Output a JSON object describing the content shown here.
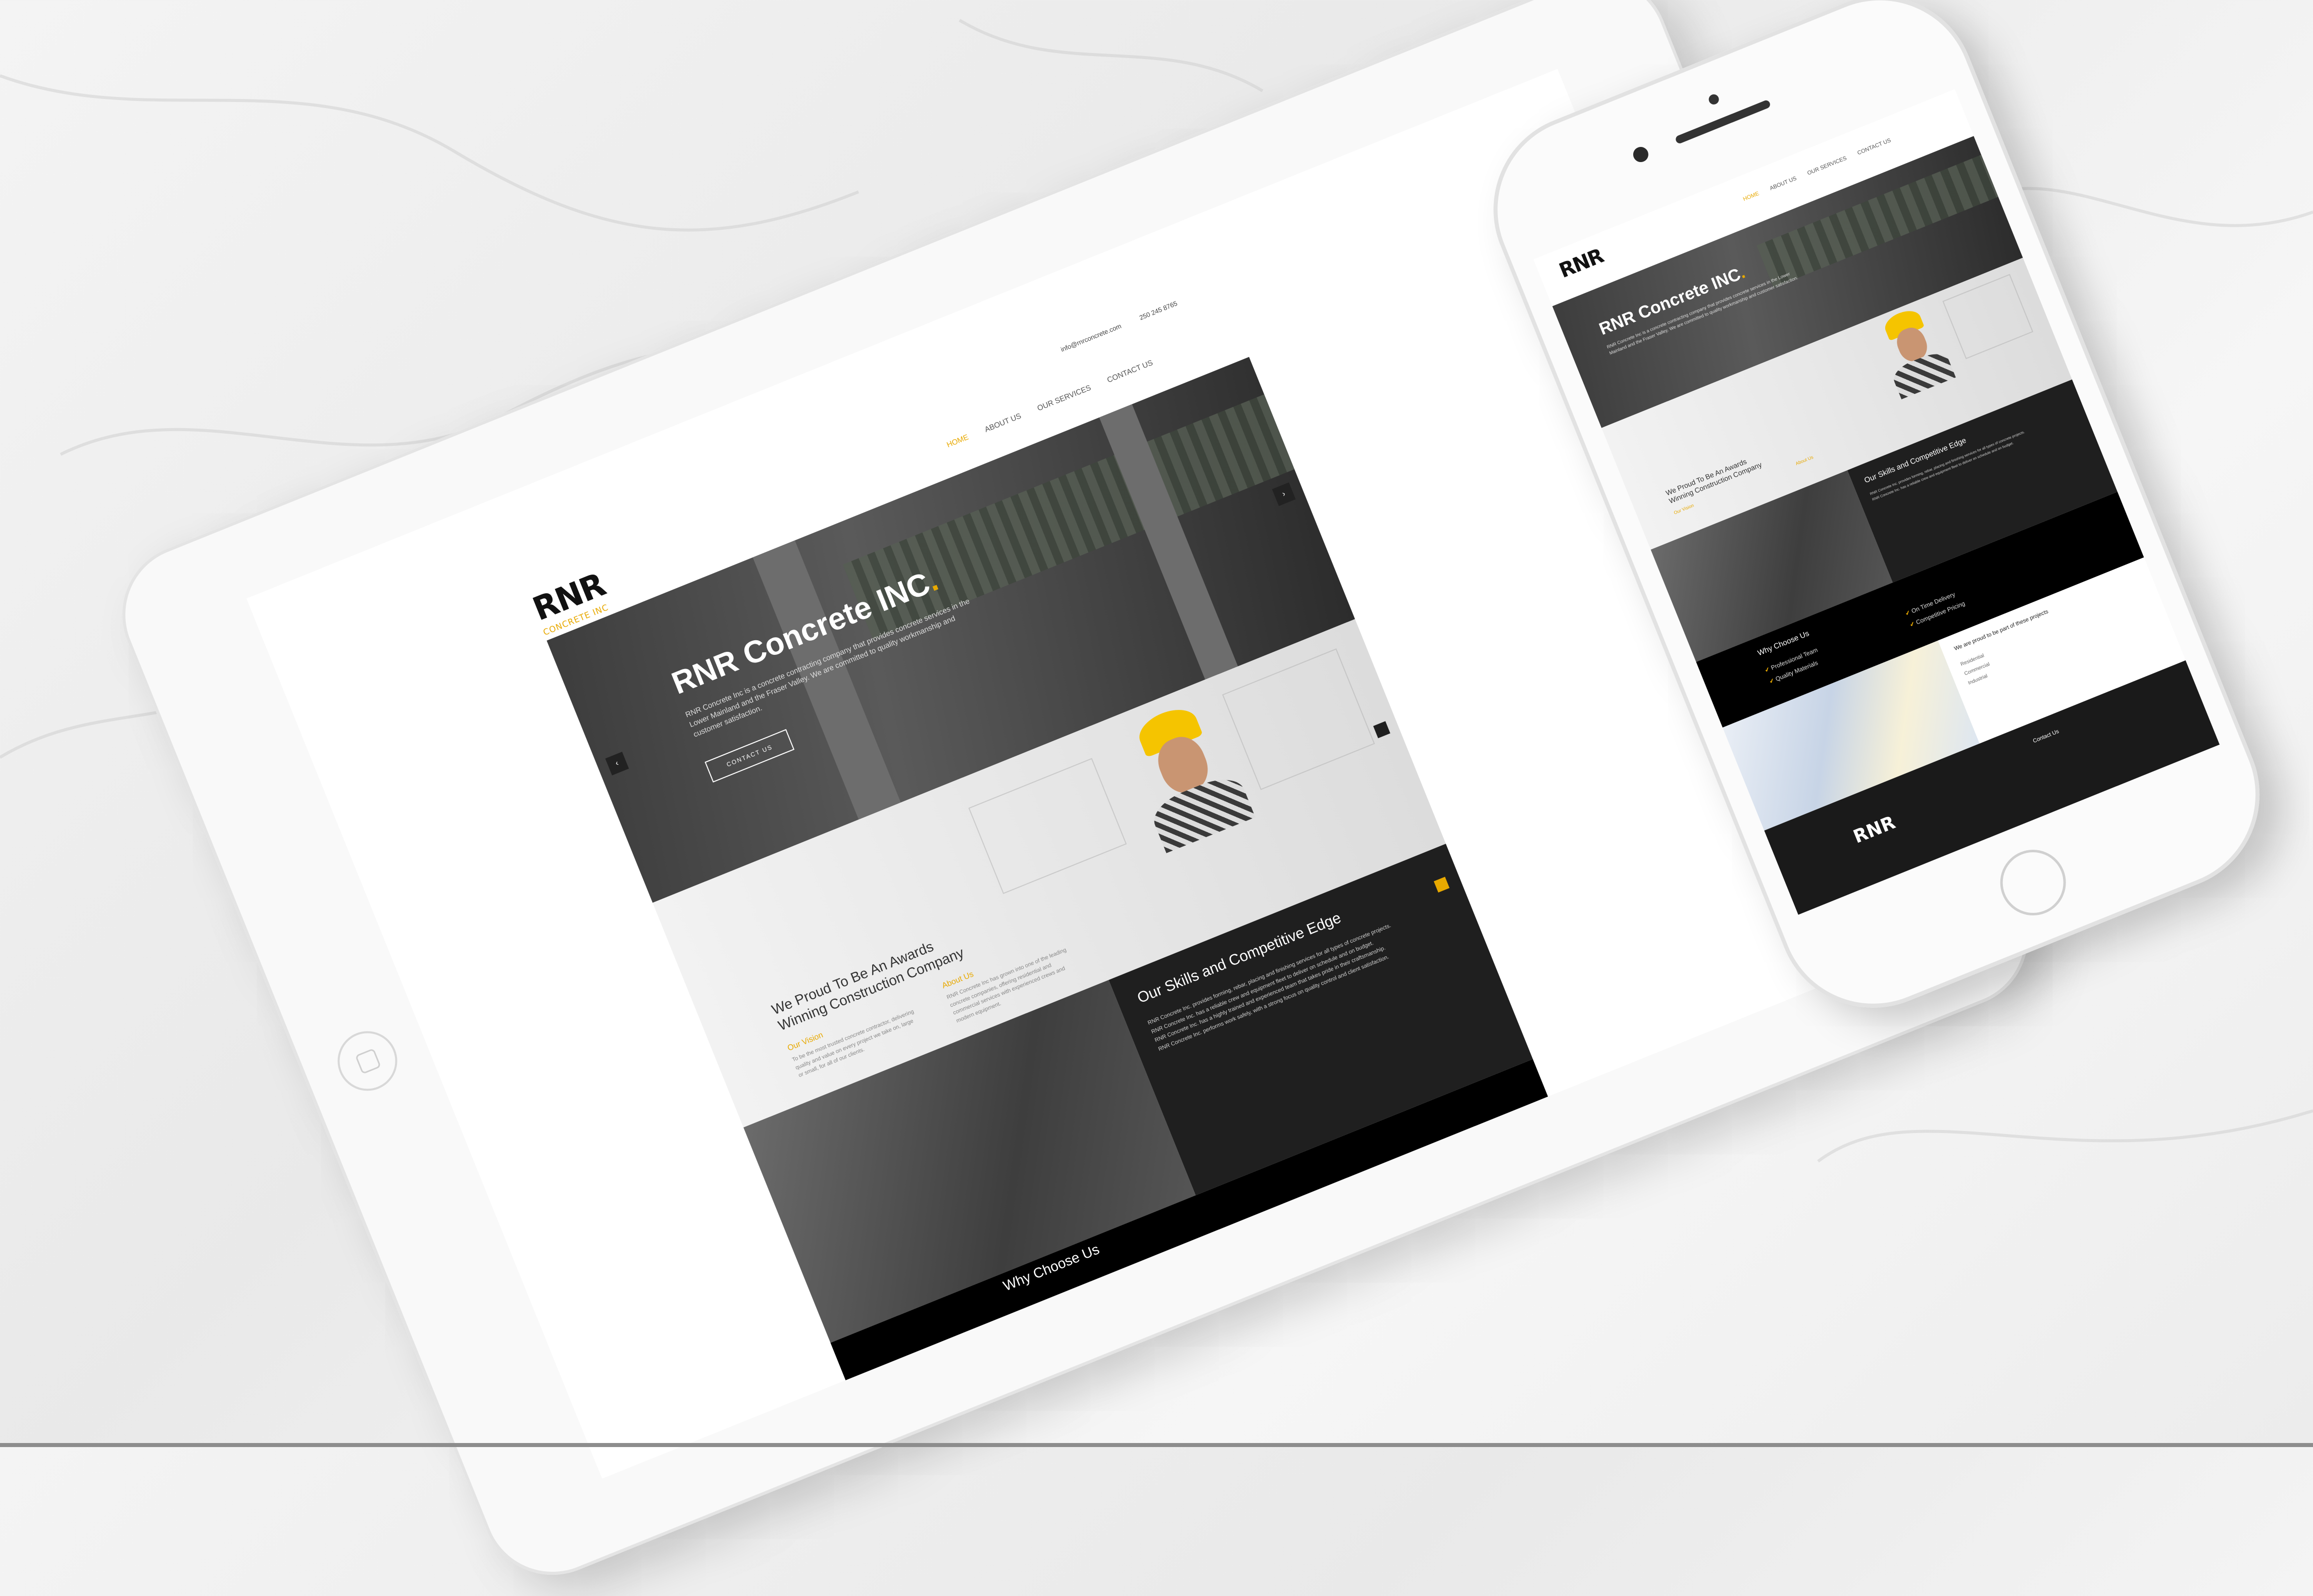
{
  "site": {
    "logo": "RNR",
    "logo_tagline": "CONCRETE INC",
    "topbar": {
      "email": "info@rnrconcrete.com",
      "phone": "250 245 8765"
    },
    "nav": [
      "HOME",
      "ABOUT US",
      "OUR SERVICES",
      "CONTACT US"
    ],
    "hero": {
      "title": "RNR Concrete INC",
      "title_dot": ".",
      "body": "RNR Concrete Inc is a concrete contracting company that provides concrete services in the Lower Mainland and the Fraser Valley. We are committed to quality workmanship and customer satisfaction.",
      "button": "CONTACT US"
    },
    "about": {
      "heading_line1": "We Proud To Be An Awards",
      "heading_line2": "Winning Construction Company",
      "vision_title": "Our Vision",
      "vision_text": "To be the most trusted concrete contractor, delivering quality and value on every project we take on, large or small, for all of our clients.",
      "about_title": "About Us",
      "about_text": "RNR Concrete Inc has grown into one of the leading concrete companies, offering residential and commercial services with experienced crews and modern equipment."
    },
    "skills": {
      "title": "Our Skills and Competitive Edge",
      "lines": [
        "RNR Concrete Inc. provides forming, rebar, placing and finishing services for all types of concrete projects.",
        "RNR Concrete Inc. has a reliable crew and equipment fleet to deliver on schedule and on budget.",
        "RNR Concrete Inc. has a highly trained and experienced team that takes pride in their craftsmanship.",
        "RNR Concrete Inc. performs work safely, with a strong focus on quality control and client satisfaction."
      ]
    },
    "why": {
      "title": "Why Choose Us",
      "items": [
        "Professional Team",
        "Quality Materials",
        "On Time Delivery",
        "Competitive Pricing"
      ]
    },
    "proud": {
      "title": "We are proud to be part of these projects",
      "items": [
        "Residential",
        "Commercial",
        "Industrial"
      ]
    },
    "footer": {
      "logo": "RNR",
      "contact_title": "Contact Us"
    }
  },
  "colors": {
    "accent": "#e8a900",
    "dark": "#1f1f1f",
    "black": "#000000"
  }
}
